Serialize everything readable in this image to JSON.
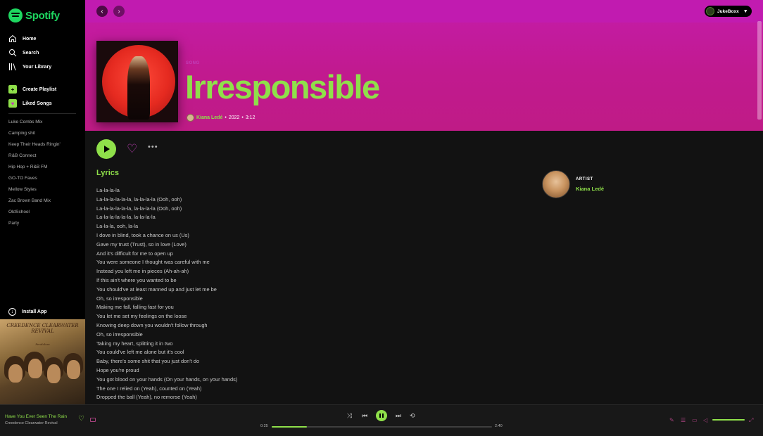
{
  "app": {
    "name": "Spotify"
  },
  "sidebar": {
    "nav": [
      {
        "label": "Home",
        "icon": "home-icon"
      },
      {
        "label": "Search",
        "icon": "search-icon"
      },
      {
        "label": "Your Library",
        "icon": "library-icon"
      }
    ],
    "actions": [
      {
        "label": "Create Playlist",
        "icon": "plus-icon",
        "color": "#8fe04a"
      },
      {
        "label": "Liked Songs",
        "icon": "heart-icon",
        "color": "#8fe04a"
      }
    ],
    "playlists": [
      "Luke Combs Mix",
      "Camping shit",
      "Keep Their Heads Ringin'",
      "R&B Connect",
      "Hip Hop + R&B FM",
      "GO-TO Faves",
      "Mellow Styles",
      "Zac Brown Band Mix",
      "OldSchool",
      "Party"
    ],
    "install_label": "Install App"
  },
  "album_art": {
    "band": "CREEDENCE CLEARWATER REVIVAL",
    "album": "Pendulum"
  },
  "topbar": {
    "user_name": "JukeBoxx"
  },
  "song": {
    "type_label": "SONG",
    "title": "Irresponsible",
    "artist": "Kiana Ledé",
    "year": "2022",
    "duration": "3:12",
    "separator": "•"
  },
  "lyrics": {
    "heading": "Lyrics",
    "lines": [
      "La-la-la-la",
      "La-la-la-la-la-la, la-la-la-la (Ooh, ooh)",
      "La-la-la-la-la-la, la-la-la-la (Ooh, ooh)",
      "La-la-la-la-la-la, la-la-la-la",
      "La-la-la, ooh, la-la",
      "I dove in blind, took a chance on us (Us)",
      "Gave my trust (Trust), so in love (Love)",
      "And it's difficult for me to open up",
      "You were someone I thought was careful with me",
      "Instead you left me in pieces (Ah-ah-ah)",
      "If this ain't where you wanted to be",
      "You should've at least manned up and just let me be",
      "Oh, so irresponsible",
      "Making me fall, falling fast for you",
      "You let me set my feelings on the loose",
      "Knowing deep down you wouldn't follow through",
      "Oh, so irresponsible",
      "Taking my heart, splitting it in two",
      "You could've left me alone but it's cool",
      "Baby, there's some shit that you just don't do",
      "Hope you're proud",
      "You got blood on your hands (On your hands, on your hands)",
      "The one I relied on (Yeah), counted on (Yeah)",
      "Dropped the ball (Yeah), no remorse (Yeah)"
    ]
  },
  "artist_card": {
    "label": "ARTIST",
    "name": "Kiana Ledé"
  },
  "now_playing": {
    "title": "Have You Ever Seen The Rain",
    "artist": "Creedence Clearwater Revival",
    "elapsed": "0:25",
    "total": "2:40",
    "progress": 0.16,
    "volume": 1.0
  },
  "colors": {
    "accent": "#8fe04a",
    "header_bg": "#c11a8f",
    "secondary_accent": "#c13fb8"
  }
}
